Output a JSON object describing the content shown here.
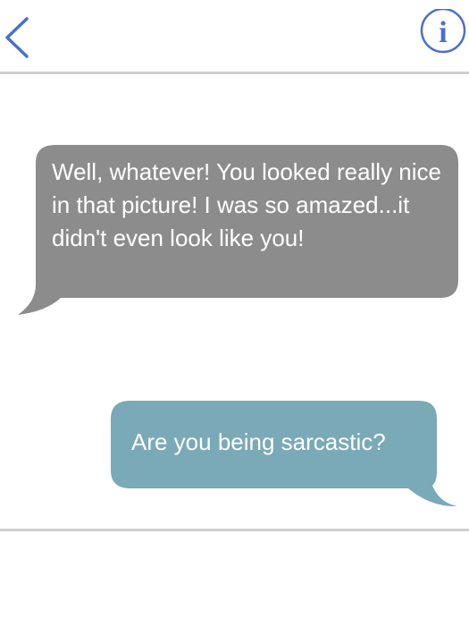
{
  "header": {
    "back_icon": "chevron-left-icon",
    "info_icon": "info-icon",
    "info_glyph": "i",
    "accent_color": "#4a6fd0"
  },
  "conversation": {
    "messages": [
      {
        "direction": "incoming",
        "text": "Well, whatever! You looked really nice in that picture! I was so amazed...it didn't even look like you!",
        "bubble_color": "#8c8c8c"
      },
      {
        "direction": "outgoing",
        "text": "Are you being sarcastic?",
        "bubble_color": "#7aa9b7"
      }
    ]
  },
  "colors": {
    "background": "#ffffff",
    "divider": "#cfcfcf",
    "message_text": "#ffffff"
  }
}
